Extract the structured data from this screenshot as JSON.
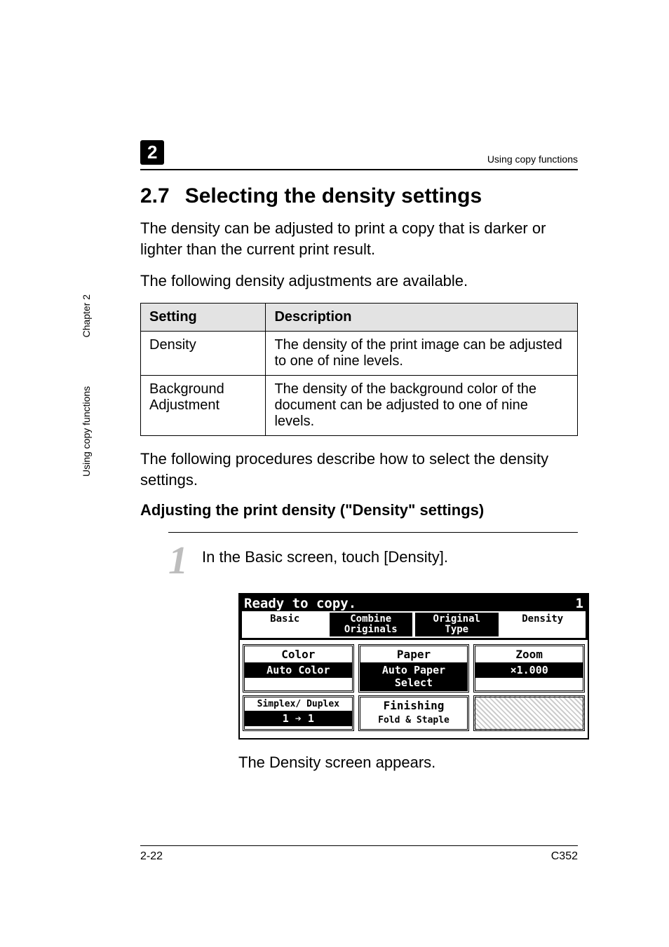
{
  "header": {
    "chapter_number": "2",
    "chapter_label": "Chapter 2",
    "running_title_full": "Using copy functions",
    "running_title_short": "Using copy functions"
  },
  "section": {
    "number": "2.7",
    "title": "Selecting the density settings"
  },
  "paragraphs": {
    "p1": "The density can be adjusted to print a copy that is darker or lighter than the current print result.",
    "p2": "The following density adjustments are available.",
    "p3": "The following procedures describe how to select the density settings."
  },
  "table": {
    "headers": {
      "c1": "Setting",
      "c2": "Description"
    },
    "rows": [
      {
        "c1": "Density",
        "c2": "The density of the print image can be adjusted to one of nine levels."
      },
      {
        "c1": "Background Adjustment",
        "c2": "The density of the background color of the document can be adjusted to one of nine levels."
      }
    ]
  },
  "subsection": {
    "title": "Adjusting the print density (\"Density\" settings)"
  },
  "step": {
    "number": "1",
    "text": "In the Basic screen, touch [Density].",
    "result": "The Density screen appears."
  },
  "lcd": {
    "status": "Ready to copy.",
    "count": "1",
    "tabs": {
      "basic": "Basic",
      "combine_l1": "Combine",
      "combine_l2": "Originals",
      "orig_l1": "Original",
      "orig_l2": "Type",
      "density": "Density"
    },
    "grid": {
      "color_label": "Color",
      "color_value": "Auto Color",
      "paper_label": "Paper",
      "paper_value": "Auto Paper Select",
      "zoom_label": "Zoom",
      "zoom_value": "×1.000",
      "duplex_label": "Simplex/ Duplex",
      "duplex_value": "1 ➔ 1",
      "finishing_label": "Finishing",
      "finishing_value": "Fold & Staple"
    }
  },
  "footer": {
    "page": "2-22",
    "model": "C352"
  }
}
